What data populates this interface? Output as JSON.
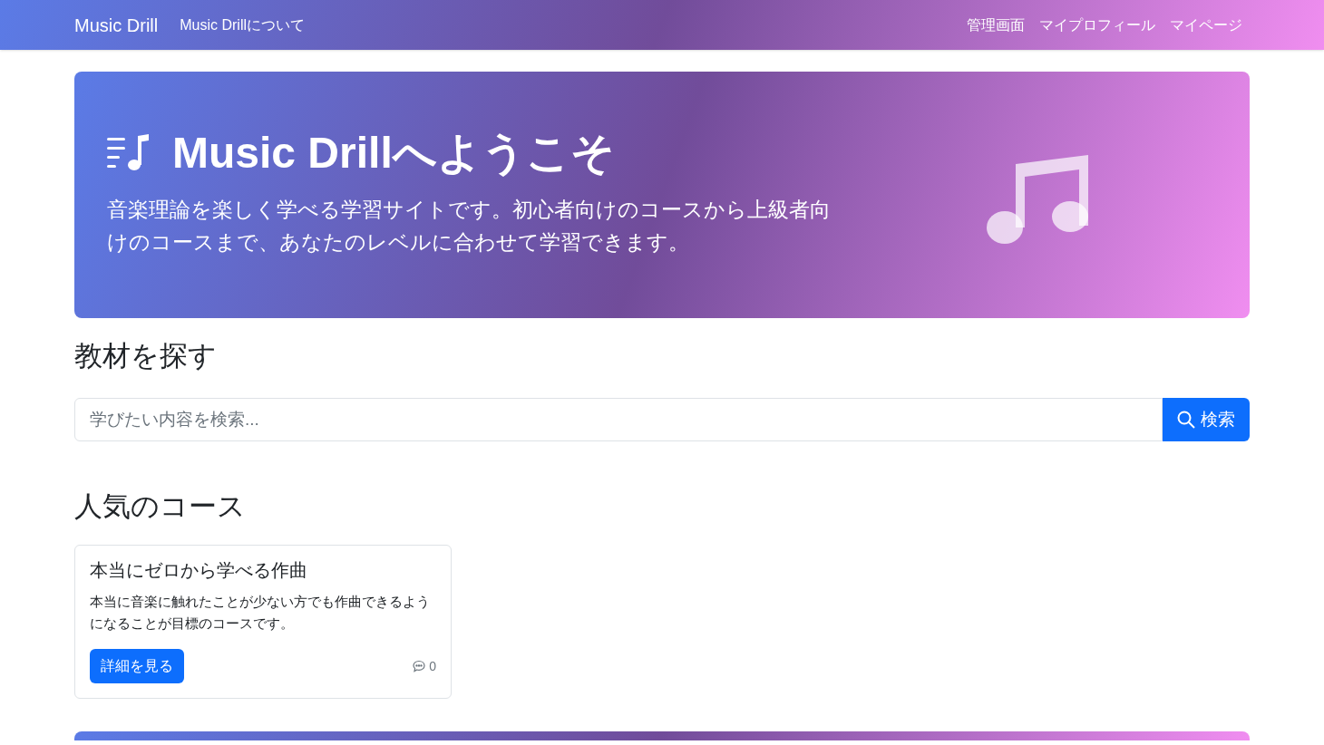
{
  "navbar": {
    "brand": "Music Drill",
    "links": [
      "Music Drillについて"
    ],
    "right_links": [
      "管理画面",
      "マイプロフィール",
      "マイページ"
    ]
  },
  "hero": {
    "title": "Music Drillへようこそ",
    "description": "音楽理論を楽しく学べる学習サイトです。初心者向けのコースから上級者向けのコースまで、あなたのレベルに合わせて学習できます。"
  },
  "search_section": {
    "heading": "教材を探す",
    "placeholder": "学びたい内容を検索...",
    "button": "検索"
  },
  "popular_courses": {
    "heading": "人気のコース",
    "courses": [
      {
        "title": "本当にゼロから学べる作曲",
        "description": "本当に音楽に触れたことが少ない方でも作曲できるようになることが目標のコースです。",
        "button": "詳細を見る",
        "comment_count": "0"
      }
    ]
  }
}
